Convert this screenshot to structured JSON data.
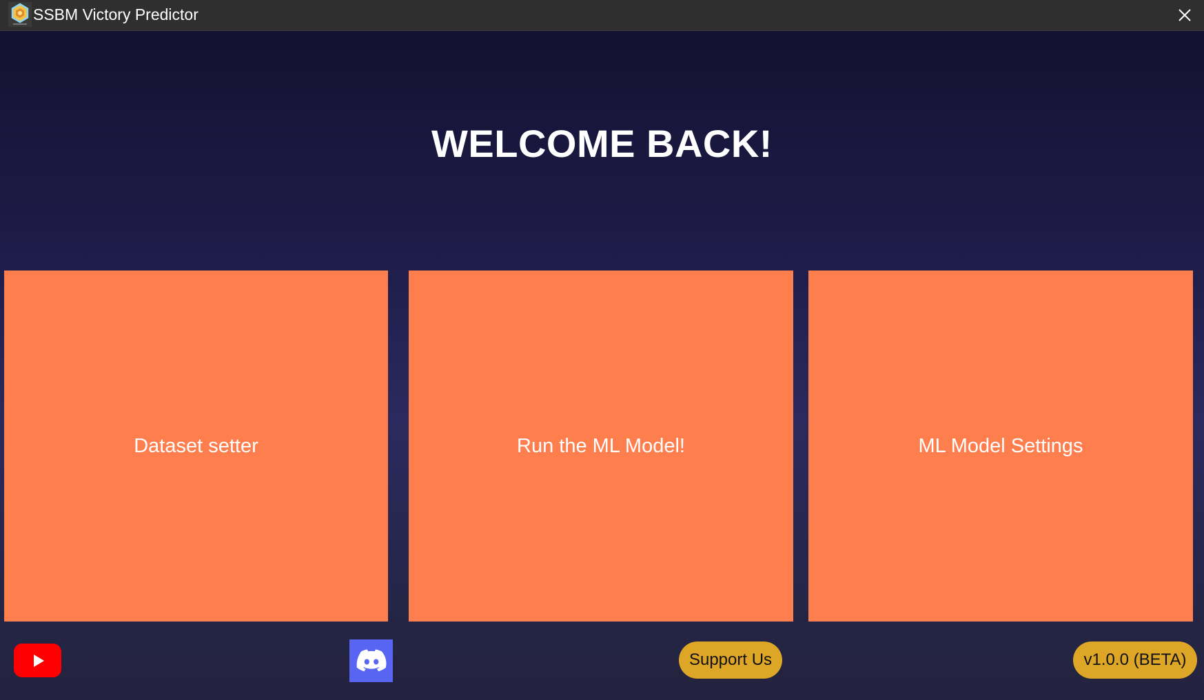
{
  "window": {
    "title": "SSBM Victory Predictor"
  },
  "main": {
    "heading": "WELCOME BACK!",
    "tiles": [
      {
        "label": "Dataset setter"
      },
      {
        "label": "Run the ML Model!"
      },
      {
        "label": "ML Model Settings"
      }
    ]
  },
  "footer": {
    "youtube_icon": "youtube-icon",
    "discord_icon": "discord-icon",
    "support_label": "Support Us",
    "version_label": "v1.0.0 (BETA)"
  },
  "colors": {
    "tile": "#ff7e4e",
    "pill": "#dea626",
    "youtube": "#ff0000",
    "discord": "#5865f2",
    "titlebar": "#2f2f2f"
  }
}
